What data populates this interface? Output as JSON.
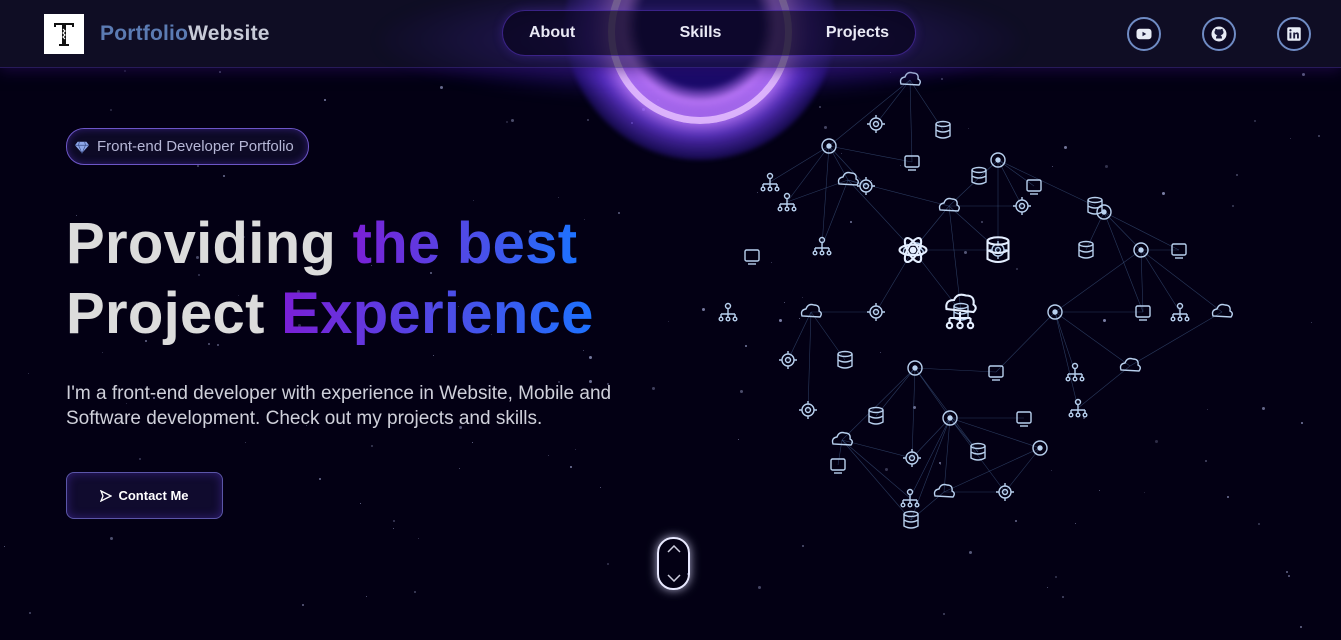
{
  "brand": {
    "part1": "Portfolio",
    "part2": "Website",
    "logo_icon": "t-logo-icon"
  },
  "nav": {
    "links": [
      "About",
      "Skills",
      "Projects"
    ]
  },
  "socials": [
    {
      "name": "youtube",
      "icon": "youtube-icon"
    },
    {
      "name": "github",
      "icon": "github-icon"
    },
    {
      "name": "linkedin",
      "icon": "linkedin-icon"
    }
  ],
  "hero": {
    "badge_icon": "diamond-icon",
    "badge_text": "Front-end Developer Portfolio",
    "headline_1a": "Providing ",
    "headline_1b": "the best",
    "headline_2a": "Project ",
    "headline_2b": "Experience",
    "subtitle": "I'm a front-end developer with experience in Website, Mobile and Software development. Check out my projects and skills.",
    "cta_icon": "send-icon",
    "cta_label": "Contact Me"
  },
  "colors": {
    "background": "#030014",
    "accent_purple": "#7b1fd6",
    "accent_blue": "#1d72ff",
    "brand_blue": "#5b7bb3"
  },
  "scroll_indicator": {
    "icon": "chevron-down-icon"
  }
}
